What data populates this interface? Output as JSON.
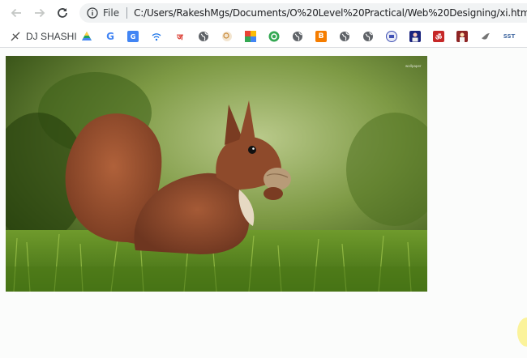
{
  "browser": {
    "back_icon": "arrow-left-icon",
    "forward_icon": "arrow-right-icon",
    "reload_icon": "reload-icon",
    "omnibox": {
      "info_icon": "info-icon",
      "scheme_label": "File",
      "url": "C:/Users/RakeshMgs/Documents/O%20Level%20Practical/Web%20Designing/xi.html"
    }
  },
  "bookmarks": [
    {
      "icon": "music-icon",
      "label": "DJ SHASHI",
      "color": "#555555"
    },
    {
      "icon": "drive-icon",
      "label": "",
      "color": "#1fa463"
    },
    {
      "icon": "google-icon",
      "label": "",
      "color": "#4285f4"
    },
    {
      "icon": "translate-icon",
      "label": "",
      "color": "#4285f4"
    },
    {
      "icon": "wifi-icon",
      "label": "",
      "color": "#1a73e8"
    },
    {
      "icon": "hindi-site-icon",
      "label": "",
      "color": "#d93025"
    },
    {
      "icon": "globe-icon",
      "label": "",
      "color": "#5f6368"
    },
    {
      "icon": "search-site-icon",
      "label": "",
      "color": "#e8a23a"
    },
    {
      "icon": "colorful-grid-icon",
      "label": "",
      "color": "#ea4335"
    },
    {
      "icon": "green-circle-icon",
      "label": "",
      "color": "#34a853"
    },
    {
      "icon": "globe-icon",
      "label": "",
      "color": "#5f6368"
    },
    {
      "icon": "blogger-icon",
      "label": "",
      "color": "#f57d00"
    },
    {
      "icon": "globe-icon",
      "label": "",
      "color": "#5f6368"
    },
    {
      "icon": "globe-icon",
      "label": "",
      "color": "#5f6368"
    },
    {
      "icon": "emblem-icon",
      "label": "",
      "color": "#3f51b5"
    },
    {
      "icon": "portrait-icon",
      "label": "",
      "color": "#1a237e"
    },
    {
      "icon": "om-icon",
      "label": "",
      "color": "#c62828"
    },
    {
      "icon": "person-icon",
      "label": "",
      "color": "#8e2424"
    },
    {
      "icon": "bird-icon",
      "label": "",
      "color": "#757575"
    },
    {
      "icon": "sst-icon",
      "label": "SST",
      "color": "#4a6fa5"
    }
  ],
  "page": {
    "image_name": "red-squirrel-photo",
    "watermark": "wallpaper"
  },
  "colors": {
    "accent": "#1a73e8",
    "cursor_highlight": "#faf18a"
  }
}
